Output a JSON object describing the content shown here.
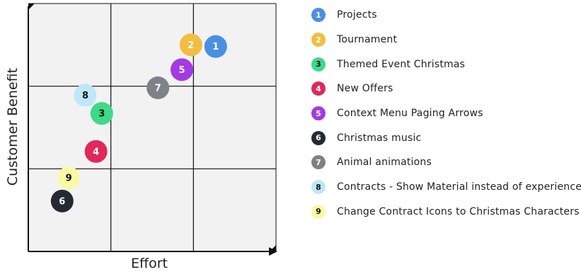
{
  "chart_data": {
    "type": "scatter",
    "xlabel": "Effort",
    "ylabel": "Customer Benefit",
    "grid": "3x3",
    "points": [
      {
        "id": "1",
        "label": "Projects",
        "x": 2.27,
        "y": 2.48,
        "color": "#4a90e2",
        "text_color": "#ffffff"
      },
      {
        "id": "2",
        "label": "Tournament",
        "x": 1.97,
        "y": 2.5,
        "color": "#f2bd40",
        "text_color": "#ffffff"
      },
      {
        "id": "3",
        "label": "Themed Event Christmas",
        "x": 0.89,
        "y": 1.67,
        "color": "#3fd98a",
        "text_color": "#111111"
      },
      {
        "id": "4",
        "label": "New Offers",
        "x": 0.82,
        "y": 1.21,
        "color": "#e0285a",
        "text_color": "#ffffff"
      },
      {
        "id": "5",
        "label": "Context Menu Paging Arrows",
        "x": 1.86,
        "y": 2.2,
        "color": "#a43ae3",
        "text_color": "#ffffff"
      },
      {
        "id": "6",
        "label": "Christmas music",
        "x": 0.41,
        "y": 0.61,
        "color": "#232a33",
        "text_color": "#ffffff"
      },
      {
        "id": "7",
        "label": "Animal animations",
        "x": 1.57,
        "y": 1.98,
        "color": "#7d8288",
        "text_color": "#ffffff"
      },
      {
        "id": "8",
        "label": "Contracts - Show Material instead of experience",
        "x": 0.69,
        "y": 1.89,
        "color": "#bde8f7",
        "text_color": "#111111"
      },
      {
        "id": "9",
        "label": "Change Contract Icons to Christmas Characters",
        "x": 0.49,
        "y": 0.89,
        "color": "#faf9a5",
        "text_color": "#111111"
      }
    ]
  }
}
